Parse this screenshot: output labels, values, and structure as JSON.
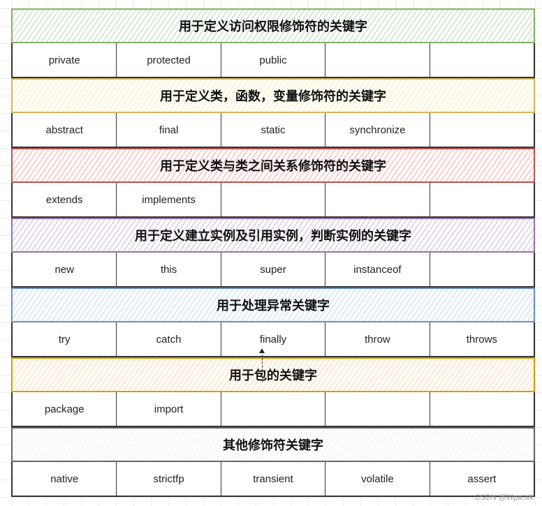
{
  "sections": [
    {
      "title": "用于定义访问权限修饰符的关键字",
      "stroke": "#82b366",
      "fill": "#d5e8d4",
      "keywords": [
        "private",
        "protected",
        "public",
        "",
        ""
      ]
    },
    {
      "title": "用于定义类，函数，变量修饰符的关键字",
      "stroke": "#d6b656",
      "fill": "#fff2cc",
      "keywords": [
        "abstract",
        "final",
        "static",
        "synchronize",
        ""
      ]
    },
    {
      "title": "用于定义类与类之间关系修饰符的关键字",
      "stroke": "#b85450",
      "fill": "#f8cecc",
      "keywords": [
        "extends",
        "implements",
        "",
        "",
        ""
      ]
    },
    {
      "title": "用于定义建立实例及引用实例，判断实例的关键字",
      "stroke": "#9673a6",
      "fill": "#e1d5e7",
      "keywords": [
        "new",
        "this",
        "super",
        "instanceof",
        ""
      ]
    },
    {
      "title": "用于处理异常关键字",
      "stroke": "#6c8ebf",
      "fill": "#dae8fc",
      "keywords": [
        "try",
        "catch",
        "finally",
        "throw",
        "throws"
      ]
    },
    {
      "title": "用于包的关键字",
      "stroke": "#d79b00",
      "fill": "#ffe6cc",
      "keywords": [
        "package",
        "import",
        "",
        "",
        ""
      ]
    },
    {
      "title": "其他修饰符关键字",
      "stroke": "#666666",
      "fill": "#f5f5f5",
      "keywords": [
        "native",
        "strictfp",
        "transient",
        "volatile",
        "assert"
      ]
    }
  ],
  "watermark": "CSDN @Wpa.wk"
}
